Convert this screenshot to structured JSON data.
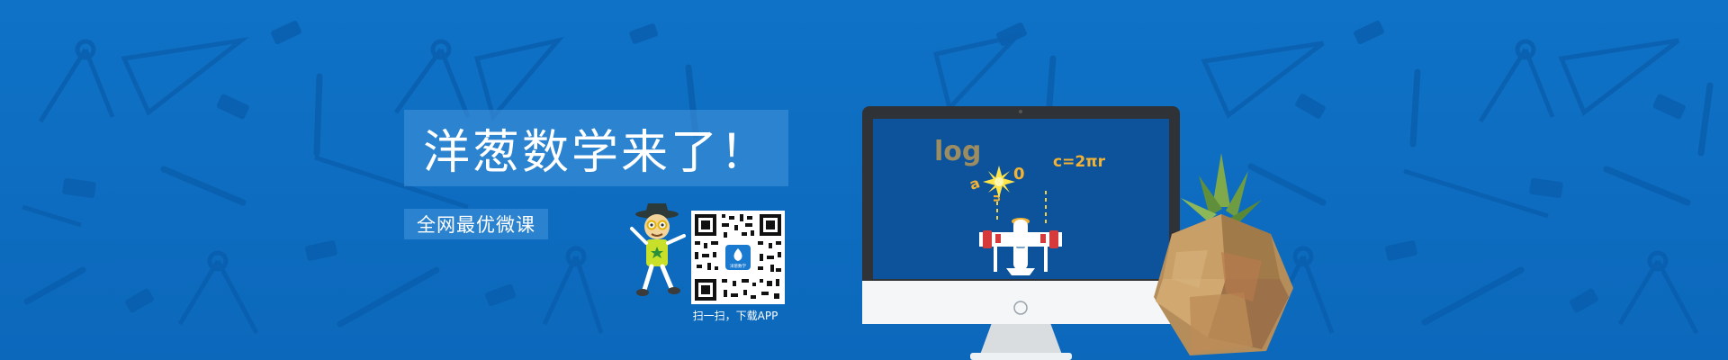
{
  "banner": {
    "headline": "洋葱数学来了！",
    "subtitle": "全网最优微课",
    "qr_caption": "扫一扫，下载APP",
    "qr_logo_text": "洋葱数学",
    "background_color": "#0d6cc0"
  },
  "screen": {
    "formula_log": "log",
    "formula_circle": "c=2πr",
    "letter_a": "a",
    "letter_o": "0",
    "letter_n": "n"
  },
  "icons": {
    "mascot": "mascot-character-icon",
    "plane": "airplane-icon",
    "pineapple": "pineapple-icon",
    "monitor": "monitor-icon",
    "qr": "qr-code-icon"
  }
}
